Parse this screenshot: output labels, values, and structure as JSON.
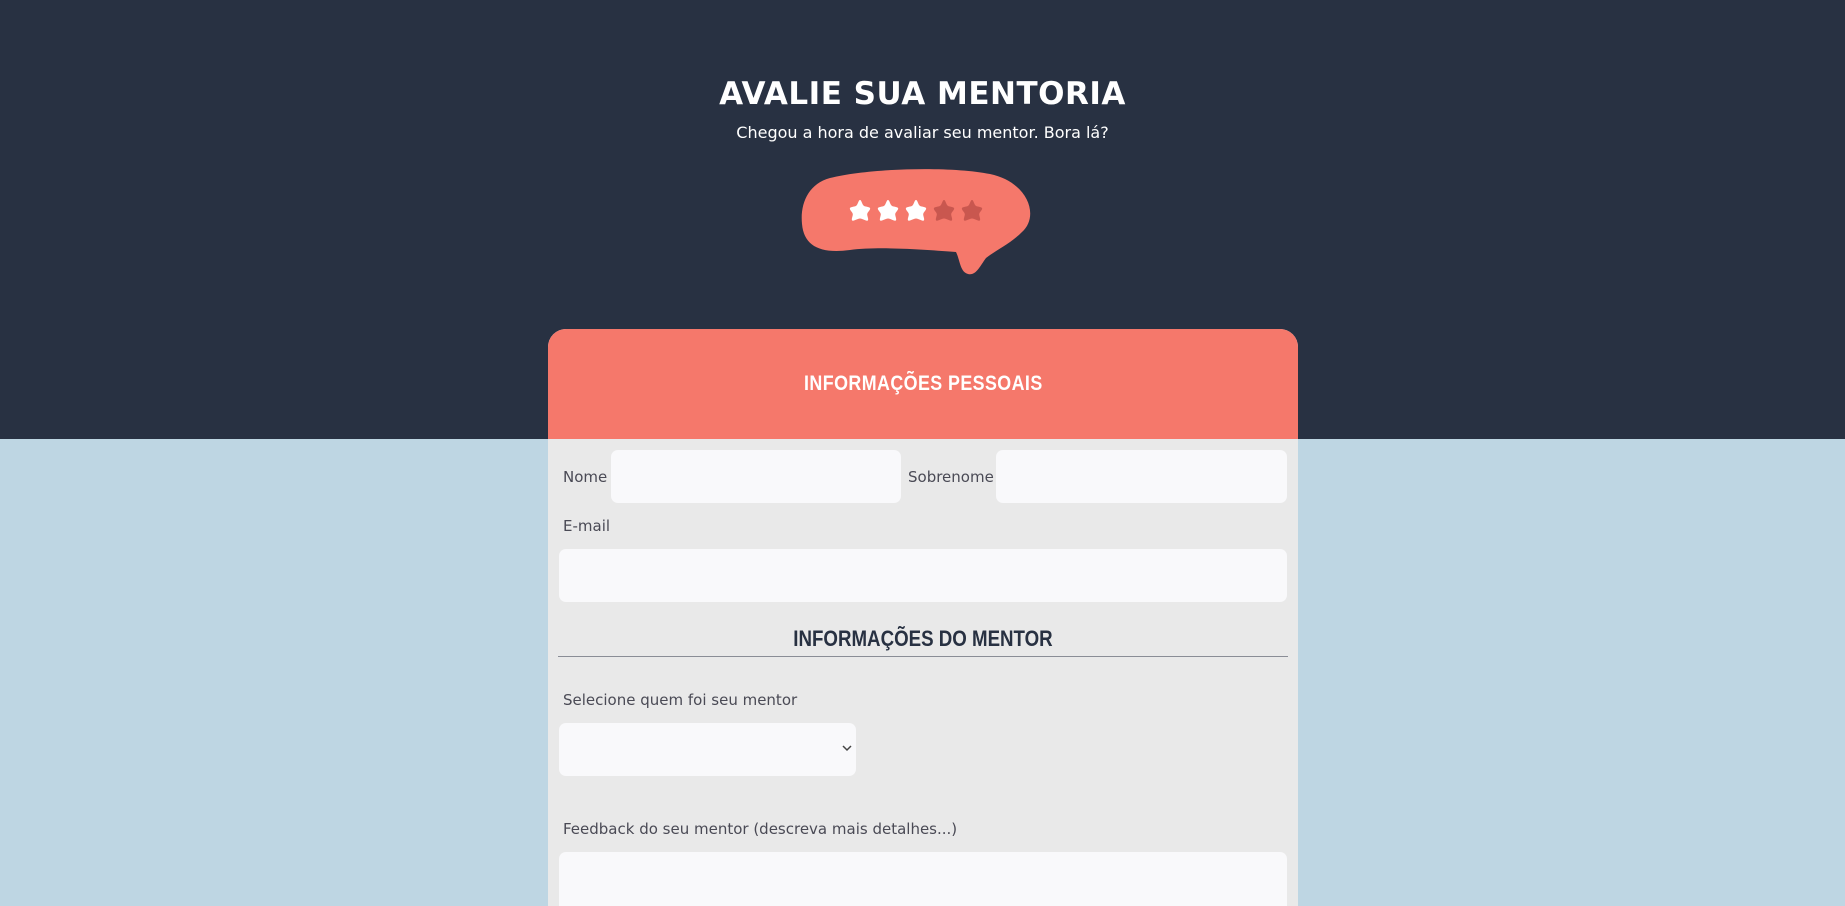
{
  "header": {
    "title": "AVALIE SUA MENTORIA",
    "subtitle": "Chegou a hora de avaliar seu mentor. Bora lá?"
  },
  "rating": {
    "value": 3,
    "max": 5,
    "bubble_color": "#f5786b",
    "star_active_color": "#ffffff",
    "star_inactive_color": "#c9574f"
  },
  "form": {
    "personal_section_title": "INFORMAÇÕES PESSOAIS",
    "first_name_label": "Nome",
    "first_name_value": "",
    "last_name_label": "Sobrenome",
    "last_name_value": "",
    "email_label": "E-mail",
    "email_value": "",
    "mentor_section_title": "INFORMAÇÕES DO MENTOR",
    "mentor_select_label": "Selecione quem foi seu mentor",
    "mentor_select_value": "",
    "feedback_label": "Feedback do seu mentor (descreva mais detalhes...)",
    "feedback_value": ""
  },
  "colors": {
    "hero_background": "#283142",
    "page_background": "#bed6e3",
    "card_background": "#e9e9e9",
    "card_header": "#f5786b",
    "input_background": "#f9f9fb"
  },
  "icons": {
    "rating_star": "star-icon",
    "select_arrow": "chevron-down-icon"
  }
}
